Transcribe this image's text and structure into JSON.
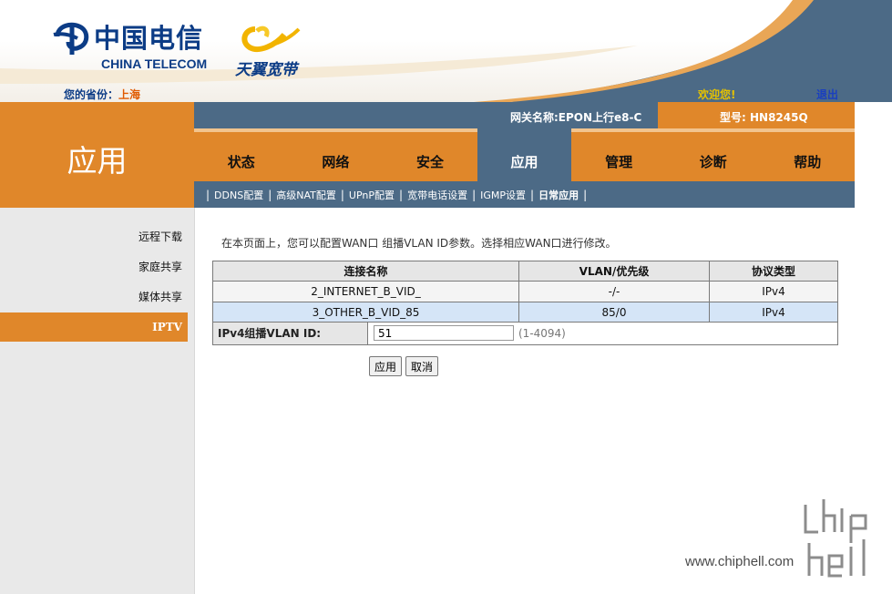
{
  "header": {
    "brand_cn": "中国电信",
    "brand_en": "CHINA TELECOM",
    "product": "天翼宽带",
    "province_label": "您的省份：",
    "province_value": "上海",
    "welcome": "欢迎您!",
    "logout": "退出"
  },
  "section_title": "应用",
  "info_bar": {
    "gateway": "网关名称:EPON上行e8-C",
    "model": "型号: HN8245Q"
  },
  "nav": {
    "tabs": [
      {
        "label": "状态"
      },
      {
        "label": "网络"
      },
      {
        "label": "安全"
      },
      {
        "label": "应用",
        "active": true
      },
      {
        "label": "管理"
      },
      {
        "label": "诊断"
      },
      {
        "label": "帮助"
      }
    ]
  },
  "subnav": {
    "items": [
      {
        "label": "DDNS配置"
      },
      {
        "label": "高级NAT配置"
      },
      {
        "label": "UPnP配置"
      },
      {
        "label": "宽带电话设置"
      },
      {
        "label": "IGMP设置"
      },
      {
        "label": "日常应用",
        "active": true
      }
    ]
  },
  "sidebar": {
    "items": [
      {
        "label": "远程下载"
      },
      {
        "label": "家庭共享"
      },
      {
        "label": "媒体共享"
      },
      {
        "label": "IPTV",
        "active": true
      }
    ]
  },
  "main": {
    "intro": "在本页面上，您可以配置WAN口 组播VLAN ID参数。选择相应WAN口进行修改。",
    "table": {
      "headers": [
        "连接名称",
        "VLAN/优先级",
        "协议类型"
      ],
      "rows": [
        {
          "name": "2_INTERNET_B_VID_",
          "vlan": "-/-",
          "protocol": "IPv4"
        },
        {
          "name": "3_OTHER_B_VID_85",
          "vlan": "85/0",
          "protocol": "IPv4",
          "selected": true
        }
      ]
    },
    "vlan_field": {
      "label": "IPv4组播VLAN ID:",
      "value": "51",
      "range": "(1-4094)"
    },
    "buttons": {
      "apply": "应用",
      "cancel": "取消"
    }
  },
  "watermark": {
    "site": "www.chiphell.com"
  },
  "colors": {
    "orange": "#e0872a",
    "steel_blue": "#4c6a86",
    "navy": "#0c3c86",
    "selected_row": "#d5e5f7"
  }
}
